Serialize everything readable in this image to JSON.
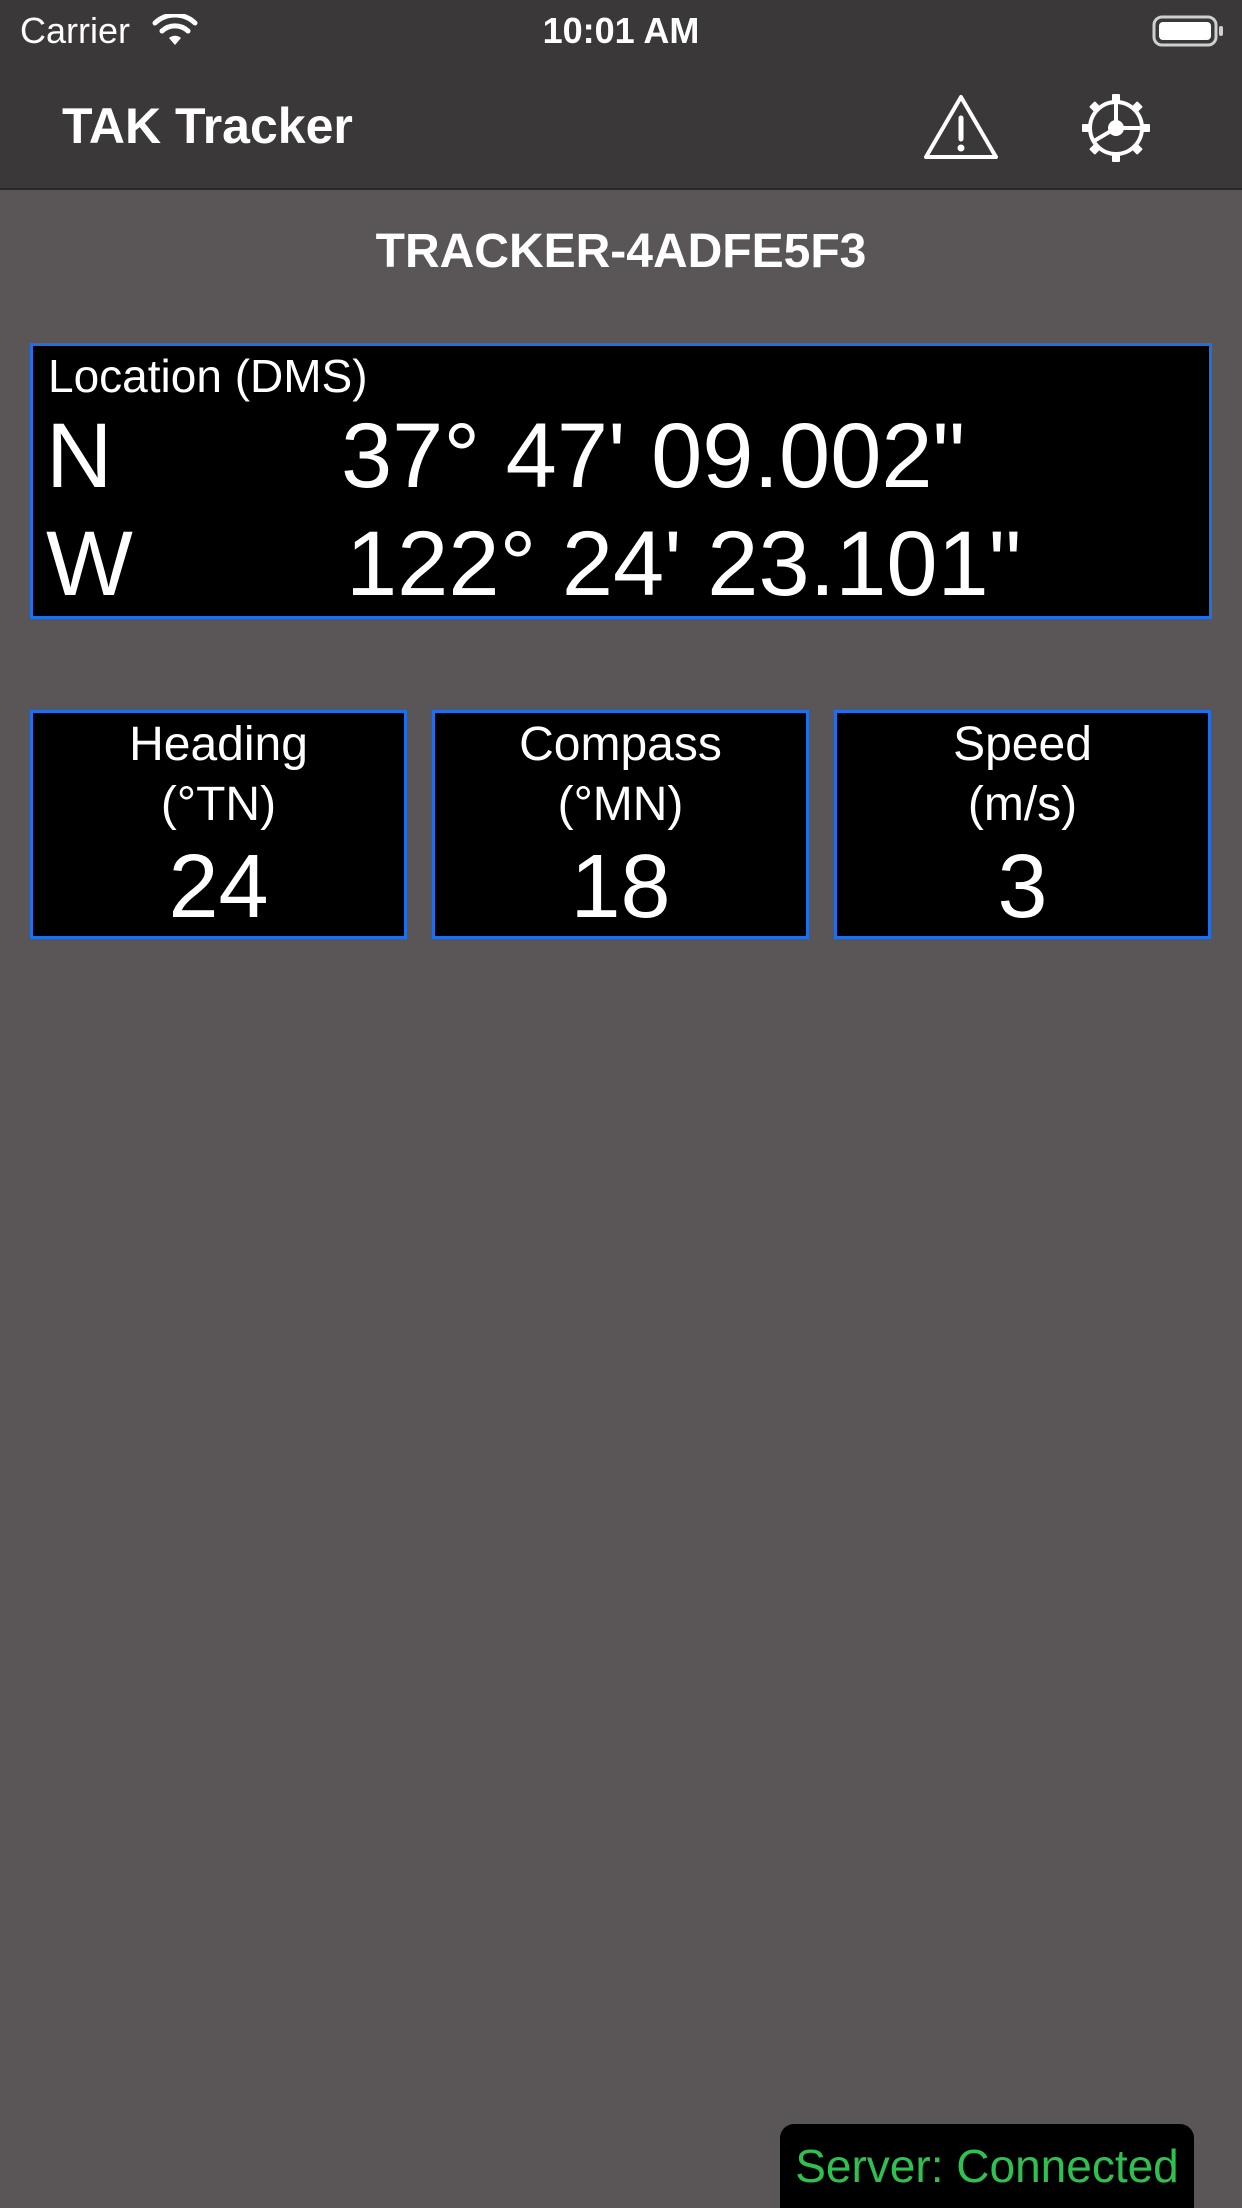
{
  "status_bar": {
    "carrier": "Carrier",
    "time": "10:01 AM",
    "wifi_icon": "wifi-icon",
    "battery_icon": "battery-icon"
  },
  "nav": {
    "title": "TAK Tracker",
    "alert_icon": "warning-triangle-icon",
    "settings_icon": "gear-icon"
  },
  "device_name": "TRACKER-4ADFE5F3",
  "location": {
    "label": "Location (DMS)",
    "latitude": {
      "hemisphere": "N",
      "value": "37° 47' 09.002\""
    },
    "longitude": {
      "hemisphere": "W",
      "value": "122° 24' 23.101\""
    }
  },
  "metrics": {
    "heading": {
      "title": "Heading",
      "unit": "(°TN)",
      "value": "24"
    },
    "compass": {
      "title": "Compass",
      "unit": "(°MN)",
      "value": "18"
    },
    "speed": {
      "title": "Speed",
      "unit": "(m/s)",
      "value": "3"
    }
  },
  "server_status": "Server: Connected",
  "colors": {
    "background": "#5a5557",
    "bar": "#3b3839",
    "panel": "#000000",
    "panel_border": "#1f6fe6",
    "connected": "#2fc14f"
  }
}
